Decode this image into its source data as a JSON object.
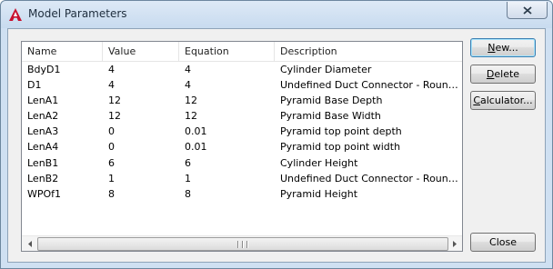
{
  "window": {
    "title": "Model Parameters"
  },
  "table": {
    "columns": [
      "Name",
      "Value",
      "Equation",
      "Description"
    ],
    "rows": [
      {
        "name": "BdyD1",
        "value": "4",
        "equation": "4",
        "description": "Cylinder Diameter"
      },
      {
        "name": "D1",
        "value": "4",
        "equation": "4",
        "description": "Undefined Duct Connector - Round Dia..."
      },
      {
        "name": "LenA1",
        "value": "12",
        "equation": "12",
        "description": "Pyramid Base Depth"
      },
      {
        "name": "LenA2",
        "value": "12",
        "equation": "12",
        "description": "Pyramid Base Width"
      },
      {
        "name": "LenA3",
        "value": "0",
        "equation": "0.01",
        "description": "Pyramid top point depth"
      },
      {
        "name": "LenA4",
        "value": "0",
        "equation": "0.01",
        "description": "Pyramid top point width"
      },
      {
        "name": "LenB1",
        "value": "6",
        "equation": "6",
        "description": "Cylinder Height"
      },
      {
        "name": "LenB2",
        "value": "1",
        "equation": "1",
        "description": "Undefined Duct Connector - Round Leng..."
      },
      {
        "name": "WPOf1",
        "value": "8",
        "equation": "8",
        "description": "Pyramid Height"
      }
    ]
  },
  "buttons": {
    "new": {
      "label": "New...",
      "mnemonic": "N"
    },
    "delete": {
      "label": "Delete",
      "mnemonic": "D"
    },
    "calculator": {
      "label": "Calculator...",
      "mnemonic": "C"
    },
    "close": {
      "label": "Close"
    }
  },
  "icons": {
    "app": "autocad-icon",
    "close": "close-icon",
    "scroll_left": "scroll-left-arrow-icon",
    "scroll_right": "scroll-right-arrow-icon"
  },
  "colors": {
    "app_icon_red": "#c8102e",
    "default_button_border": "#3c7fb1"
  }
}
